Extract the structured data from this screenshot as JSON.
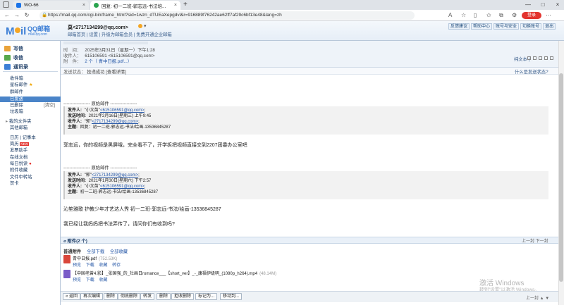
{
  "browser": {
    "tabs": [
      {
        "title": "WO-66"
      },
      {
        "title": "回复: 初一二班-郭志远-书法培..."
      }
    ],
    "new_tab": "+",
    "url": "https://mail.qq.com/cgi-bin/frame_html?sid=1wzn_dTUEaXepgdvl&r=916889f76242ae62ff7af29c6bf13e48&lang=zh",
    "login_label": "登录"
  },
  "header": {
    "logo_text": "QQ邮箱",
    "logo_sub": "mail.qq.com",
    "user_email": "莫<2717134299@qq.com>",
    "user_links": "邮箱首页 | 设置 | 升级为邮箱会员 | 免费开通企业邮箱",
    "top_links": [
      "反馈建议",
      "帮助中心",
      "账号与安全",
      "切换账号",
      "退出"
    ]
  },
  "nav": {
    "write": "写信",
    "inbox": "收信",
    "contacts": "通讯录",
    "items": [
      {
        "label": "收件箱"
      },
      {
        "label": "星标邮件"
      },
      {
        "label": "群邮件"
      },
      {
        "label": "已发送"
      },
      {
        "label": "已删除"
      },
      {
        "label": "垃圾箱"
      },
      {
        "label": "我的文件夹"
      },
      {
        "label": "其他邮箱"
      },
      {
        "label": "日历 | 记事本"
      },
      {
        "label": "简历"
      },
      {
        "label": "发票助手"
      },
      {
        "label": "在线文档"
      },
      {
        "label": "每日悦读"
      },
      {
        "label": "附件收藏"
      },
      {
        "label": "文件中转站"
      },
      {
        "label": "贺卡"
      }
    ],
    "empty_label": "[清空]",
    "new_badge": "NEW"
  },
  "message": {
    "time_label": "时　间：",
    "time_value": "2025年3月31日（星期一）下午1:28",
    "to_label": "收件人：",
    "to_value": "615106591 <615106591@qq.com>",
    "attach_label": "附　件：",
    "attach_value": "2 个（ 青中日报.pdf...）",
    "toolbar_right": "纯文本 |",
    "status_label": "发送状态：",
    "status_value": "投递成功 [查看详情]",
    "status_link": "什么是发送状态?"
  },
  "quote1": {
    "sep": "------------------ 原始邮件 ------------------",
    "from_label": "发件人:",
    "from_name": "\"小文苗\"",
    "from_email": "<615106591@qq.com>",
    "date_label": "发送时间:",
    "date_value": "2021年2月16日(星期三) 上午9:45",
    "to_label": "收件人:",
    "to_name": "\"郭\"",
    "to_email": "<2717134299@qq.com>",
    "subject_label": "主题:",
    "subject_value": "回复：初一二班-郭志远-书法/绘画-13536845287"
  },
  "body1": "郭志远，你的视频是黑屏哦，完全看不了，开学拆把视频直接交到2207团委办公室吧",
  "quote2": {
    "sep": "------------------ 原始邮件 ------------------",
    "from_label": "发件人:",
    "from_name": "\"郭\"",
    "from_email": "<2717134299@qq.com>",
    "date_label": "发送时间:",
    "date_value": "2021年1月30日(星期六) 下午2:57",
    "to_label": "收件人:",
    "to_name": "\"小文苗\"",
    "to_email": "<615106591@qq.com>",
    "subject_label": "主题:",
    "subject_value": "初一二班-郭志远-书法/绘画-13536845287"
  },
  "body2": "沁笙雅歌 护教少年才艺达人秀 初一二班-郭志远-书法/绘画-13536845287",
  "body3": "我已经让我妈妈把书法弄传了，请问你们有收到吗?",
  "attachments": {
    "title": "附件(2 个)",
    "pager": "上一封 下一封",
    "normal_label": "普通附件",
    "download_all": "全部下载",
    "save_all": "全部收藏",
    "files": [
      {
        "name": "青中日报.pdf",
        "size": "(752.53K)",
        "ops": [
          "预览",
          "下载",
          "收藏",
          "转存"
        ]
      },
      {
        "name": "【中国老曾4.影】_张国强_的_社画日romance___【short_ver】_-_康福伊级明_(1080p_h264).mp4",
        "size": "(48.14M)",
        "ops": [
          "预览",
          "下载",
          "收藏"
        ]
      }
    ]
  },
  "bottom_toolbar": {
    "buttons": [
      "« 返回",
      "再次编辑",
      "删除",
      "彻底删除",
      "转发",
      "删除",
      "拒收删除",
      "标记为...",
      "移动到..."
    ],
    "pager": "上一封 ▲ ▼"
  },
  "watermark": {
    "line1": "激活 Windows",
    "line2": "转到\"设置\"以激活 Windows。"
  }
}
